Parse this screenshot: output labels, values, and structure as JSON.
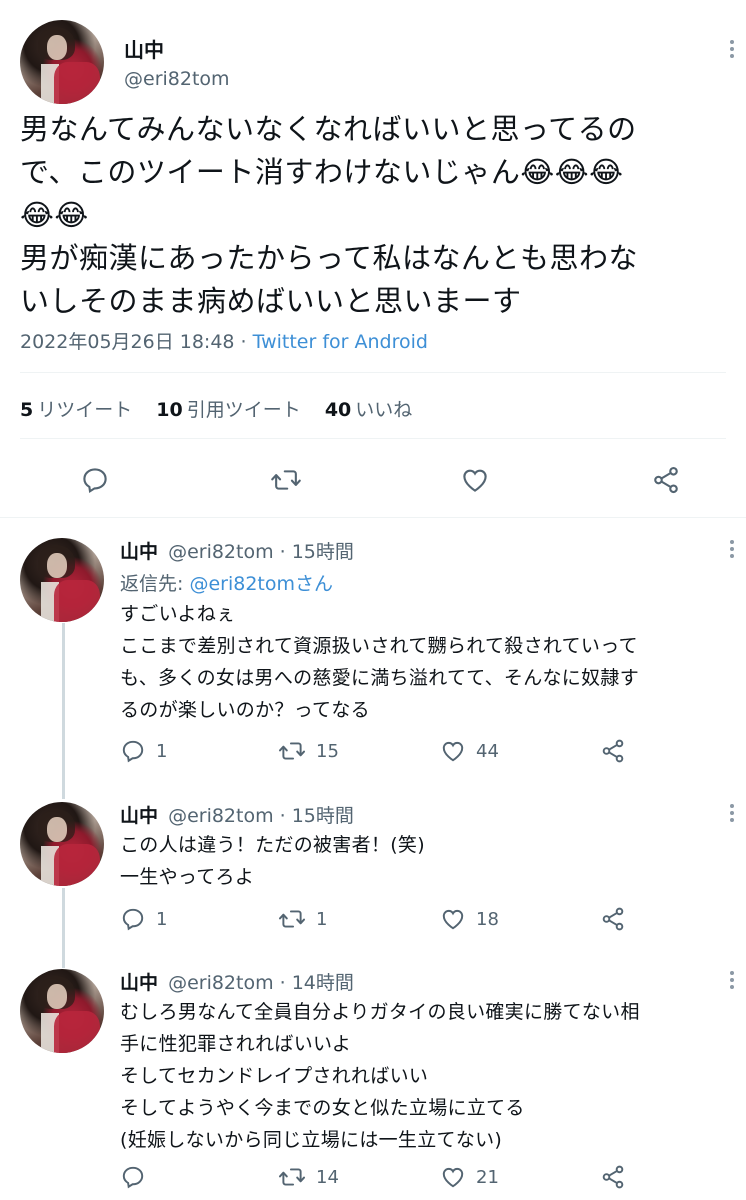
{
  "main_tweet": {
    "display_name": "山中",
    "handle": "@eri82tom",
    "text_lines": [
      "男なんてみんないなくなればいいと思ってるの",
      "で、このツイート消すわけないじゃん😂😂😂",
      "😂😂",
      "男が痴漢にあったからって私はなんとも思わな",
      "いしそのまま病めばいいと思いまーす"
    ],
    "timestamp": "2022年05月26日 18:48 · ",
    "source": "Twitter for Android",
    "stats": {
      "retweets_count": "5",
      "retweets_label": "リツイート",
      "quotes_count": "10",
      "quotes_label": "引用ツイート",
      "likes_count": "40",
      "likes_label": "いいね"
    }
  },
  "replies": [
    {
      "display_name": "山中",
      "handle_time": "@eri82tom · 15時間",
      "reply_to_prefix": "返信先: ",
      "reply_to_user": "@eri82tomさん",
      "text_lines": [
        "すごいよねぇ",
        "ここまで差別されて資源扱いされて嬲られて殺されていって",
        "も、多くの女は男への慈愛に満ち溢れてて、そんなに奴隷す",
        "るのが楽しいのか？ってなる"
      ],
      "replies": "1",
      "retweets": "15",
      "likes": "44"
    },
    {
      "display_name": "山中",
      "handle_time": "@eri82tom · 15時間",
      "text_lines": [
        "この人は違う！ただの被害者！(笑)",
        "一生やってろよ"
      ],
      "replies": "1",
      "retweets": "1",
      "likes": "18"
    },
    {
      "display_name": "山中",
      "handle_time": "@eri82tom · 14時間",
      "text_lines": [
        "むしろ男なんて全員自分よりガタイの良い確実に勝てない相",
        "手に性犯罪されればいいよ",
        "そしてセカンドレイプされればいい",
        "そしてようやく今までの女と似た立場に立てる",
        "(妊娠しないから同じ立場には一生立てない)"
      ],
      "replies": "",
      "retweets": "14",
      "likes": "21"
    }
  ],
  "colors": {
    "text": "#0f1419",
    "secondary": "#536471",
    "link": "#3d8fd6",
    "divider": "#eff3f4",
    "thread_line": "#cfd9de"
  },
  "icons": [
    "reply-icon",
    "retweet-icon",
    "like-icon",
    "share-icon",
    "more-icon"
  ]
}
